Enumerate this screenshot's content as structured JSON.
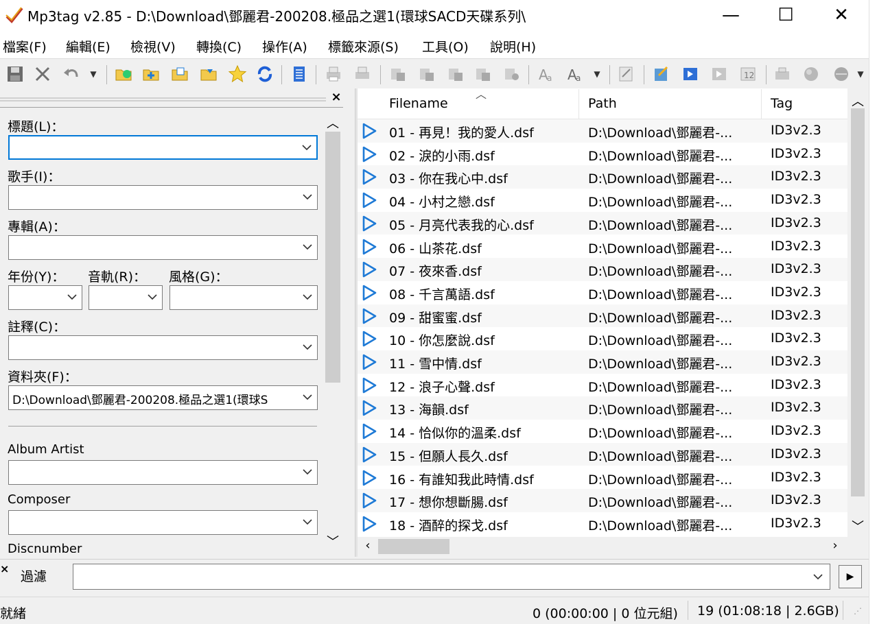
{
  "window": {
    "title": "Mp3tag v2.85  -  D:\\Download\\鄧麗君-200208.極品之選1(環球SACD天碟系列\\",
    "minimize": "—",
    "maximize": "☐",
    "close": "✕"
  },
  "menu": [
    "檔案(F)",
    "編輯(E)",
    "檢視(V)",
    "轉換(C)",
    "操作(A)",
    "標籤來源(S)",
    "工具(O)",
    "說明(H)"
  ],
  "toolbar": {
    "icons": [
      "save-icon",
      "remove-tag-icon",
      "undo-icon",
      "change-dir-icon",
      "add-dir-icon",
      "open-playlist-icon",
      "save-playlist-icon",
      "favorites-icon",
      "refresh-icon",
      "extended-tags-icon",
      "print-icon",
      "export-icon",
      "tag-to-filename-icon",
      "filename-to-tag-icon",
      "text-to-tag-icon",
      "tag-to-tag-icon",
      "actions-icon",
      "case-conversion-icon",
      "text-case-icon",
      "edit-icon",
      "quick-action-icon",
      "freedb-icon",
      "discogs-icon",
      "autonumber-icon",
      "play-icon",
      "web-source-icon",
      "cover-icon"
    ]
  },
  "tag_panel": {
    "close_label": "×",
    "fields": {
      "title_label": "標題(L)：",
      "title_value": "",
      "artist_label": "歌手(I)：",
      "artist_value": "",
      "album_label": "專輯(A)：",
      "album_value": "",
      "year_label": "年份(Y)：",
      "year_value": "",
      "track_label": "音軌(R)：",
      "track_value": "",
      "genre_label": "風格(G)：",
      "genre_value": "",
      "comment_label": "註釋(C)：",
      "comment_value": "",
      "directory_label": "資料夾(F)：",
      "directory_value": "D:\\Download\\鄧麗君-200208.極品之選1(環球S",
      "album_artist_label": "Album Artist",
      "album_artist_value": "",
      "composer_label": "Composer",
      "composer_value": "",
      "discnumber_label": "Discnumber"
    }
  },
  "file_list": {
    "columns": [
      "Filename",
      "Path",
      "Tag"
    ],
    "rows": [
      {
        "filename": "01 - 再見！我的愛人.dsf",
        "path": "D:\\Download\\鄧麗君-...",
        "tag": "ID3v2.3"
      },
      {
        "filename": "02 - 淚的小雨.dsf",
        "path": "D:\\Download\\鄧麗君-...",
        "tag": "ID3v2.3"
      },
      {
        "filename": "03 - 你在我心中.dsf",
        "path": "D:\\Download\\鄧麗君-...",
        "tag": "ID3v2.3"
      },
      {
        "filename": "04 - 小村之戀.dsf",
        "path": "D:\\Download\\鄧麗君-...",
        "tag": "ID3v2.3"
      },
      {
        "filename": "05 - 月亮代表我的心.dsf",
        "path": "D:\\Download\\鄧麗君-...",
        "tag": "ID3v2.3"
      },
      {
        "filename": "06 - 山茶花.dsf",
        "path": "D:\\Download\\鄧麗君-...",
        "tag": "ID3v2.3"
      },
      {
        "filename": "07 - 夜來香.dsf",
        "path": "D:\\Download\\鄧麗君-...",
        "tag": "ID3v2.3"
      },
      {
        "filename": "08 - 千言萬語.dsf",
        "path": "D:\\Download\\鄧麗君-...",
        "tag": "ID3v2.3"
      },
      {
        "filename": "09 - 甜蜜蜜.dsf",
        "path": "D:\\Download\\鄧麗君-...",
        "tag": "ID3v2.3"
      },
      {
        "filename": "10 - 你怎麼說.dsf",
        "path": "D:\\Download\\鄧麗君-...",
        "tag": "ID3v2.3"
      },
      {
        "filename": "11 - 雪中情.dsf",
        "path": "D:\\Download\\鄧麗君-...",
        "tag": "ID3v2.3"
      },
      {
        "filename": "12 - 浪子心聲.dsf",
        "path": "D:\\Download\\鄧麗君-...",
        "tag": "ID3v2.3"
      },
      {
        "filename": "13 - 海韻.dsf",
        "path": "D:\\Download\\鄧麗君-...",
        "tag": "ID3v2.3"
      },
      {
        "filename": "14 - 恰似你的溫柔.dsf",
        "path": "D:\\Download\\鄧麗君-...",
        "tag": "ID3v2.3"
      },
      {
        "filename": "15 - 但願人長久.dsf",
        "path": "D:\\Download\\鄧麗君-...",
        "tag": "ID3v2.3"
      },
      {
        "filename": "16 - 有誰知我此時情.dsf",
        "path": "D:\\Download\\鄧麗君-...",
        "tag": "ID3v2.3"
      },
      {
        "filename": "17 - 想你想斷腸.dsf",
        "path": "D:\\Download\\鄧麗君-...",
        "tag": "ID3v2.3"
      },
      {
        "filename": "18 - 酒醉的探戈.dsf",
        "path": "D:\\Download\\鄧麗君-...",
        "tag": "ID3v2.3"
      }
    ]
  },
  "filter": {
    "label": "過濾",
    "value": "",
    "close": "×",
    "go": "▶"
  },
  "status": {
    "left": "就緒",
    "selected": "0 (00:00:00 | 0 位元組)",
    "total": "19 (01:08:18 | 2.6GB)"
  },
  "colors": {
    "accent": "#0078d7",
    "play_icon": "#1e7ad6"
  }
}
